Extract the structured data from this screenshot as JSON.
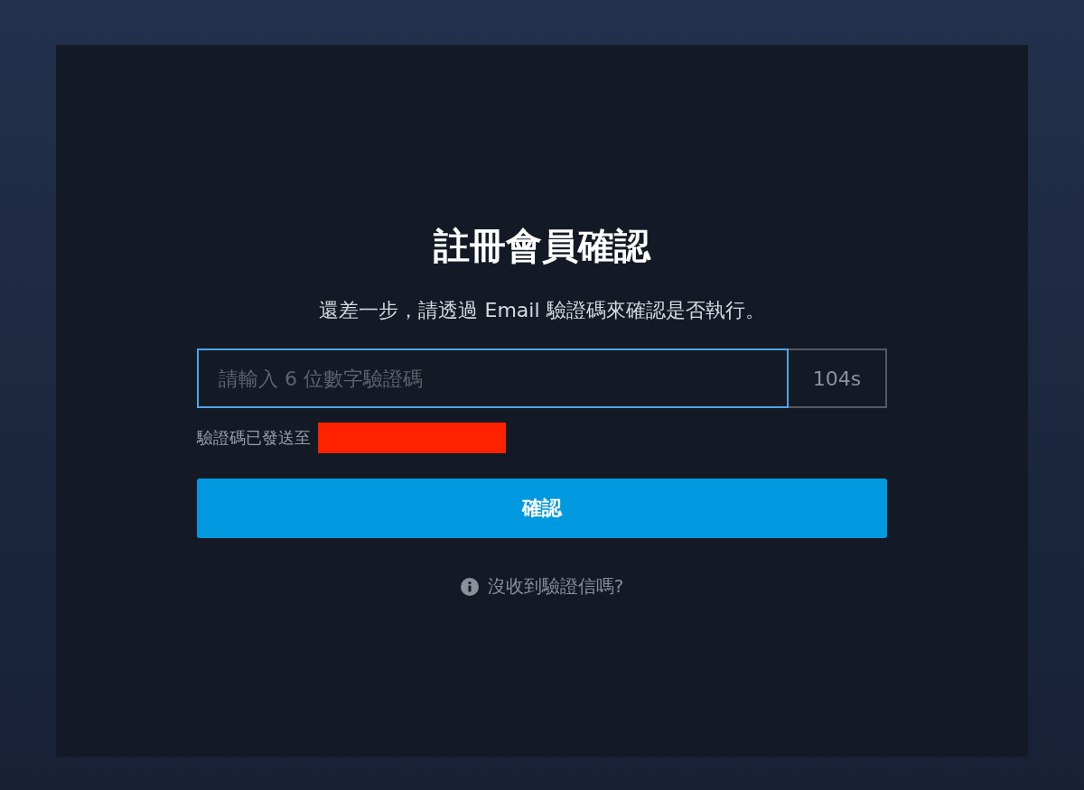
{
  "title": "註冊會員確認",
  "subtitle": "還差一步，請透過 Email 驗證碼來確認是否執行。",
  "code_field": {
    "placeholder": "請輸入 6 位數字驗證碼",
    "focused": true
  },
  "countdown": "104s",
  "sent_notice": "驗證碼已發送至",
  "confirm_button": "確認",
  "help_link": "沒收到驗證信嗎?"
}
